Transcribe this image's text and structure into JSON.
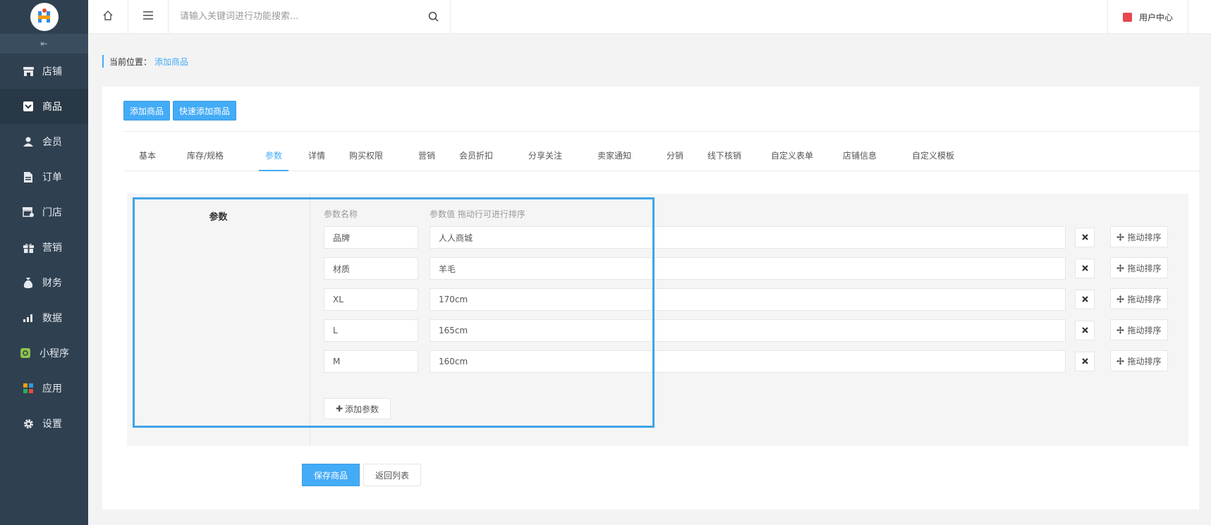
{
  "sidebar": {
    "collapse_glyph": "⇤",
    "items": [
      {
        "label": "店铺",
        "icon": "shop-icon"
      },
      {
        "label": "商品",
        "icon": "goods-icon"
      },
      {
        "label": "会员",
        "icon": "member-icon"
      },
      {
        "label": "订单",
        "icon": "order-icon"
      },
      {
        "label": "门店",
        "icon": "store-icon"
      },
      {
        "label": "营销",
        "icon": "gift-icon"
      },
      {
        "label": "财务",
        "icon": "money-bag-icon"
      },
      {
        "label": "数据",
        "icon": "bar-chart-icon"
      },
      {
        "label": "小程序",
        "icon": "miniapp-icon"
      },
      {
        "label": "应用",
        "icon": "apps-grid-icon"
      },
      {
        "label": "设置",
        "icon": "gear-icon"
      }
    ],
    "active_index": 1
  },
  "topbar": {
    "search_placeholder": "请输入关键词进行功能搜索...",
    "user_center": "用户中心"
  },
  "breadcrumb": {
    "label": "当前位置：",
    "current": "添加商品"
  },
  "top_buttons": {
    "add_goods": "添加商品",
    "quick_add_goods": "快速添加商品"
  },
  "tabs": [
    "基本",
    "库存/规格",
    "参数",
    "详情",
    "购买权限",
    "营销",
    "会员折扣",
    "分享关注",
    "卖家通知",
    "分销",
    "线下核销",
    "自定义表单",
    "店铺信息",
    "自定义模板"
  ],
  "active_tab": 2,
  "params": {
    "section_label": "参数",
    "name_header": "参数名称",
    "value_header": "参数值 拖动行可进行排序",
    "rows": [
      {
        "name": "品牌",
        "value": "人人商城"
      },
      {
        "name": "材质",
        "value": "羊毛"
      },
      {
        "name": "XL",
        "value": "170cm"
      },
      {
        "name": "L",
        "value": "165cm"
      },
      {
        "name": "M",
        "value": "160cm"
      }
    ],
    "drag_label": "拖动排序",
    "add_label": "添加参数"
  },
  "footer": {
    "save": "保存商品",
    "back": "返回列表"
  },
  "colors": {
    "sidebar_bg": "#2f4050",
    "accent": "#44abf7",
    "highlight": "#3fa4e8"
  }
}
